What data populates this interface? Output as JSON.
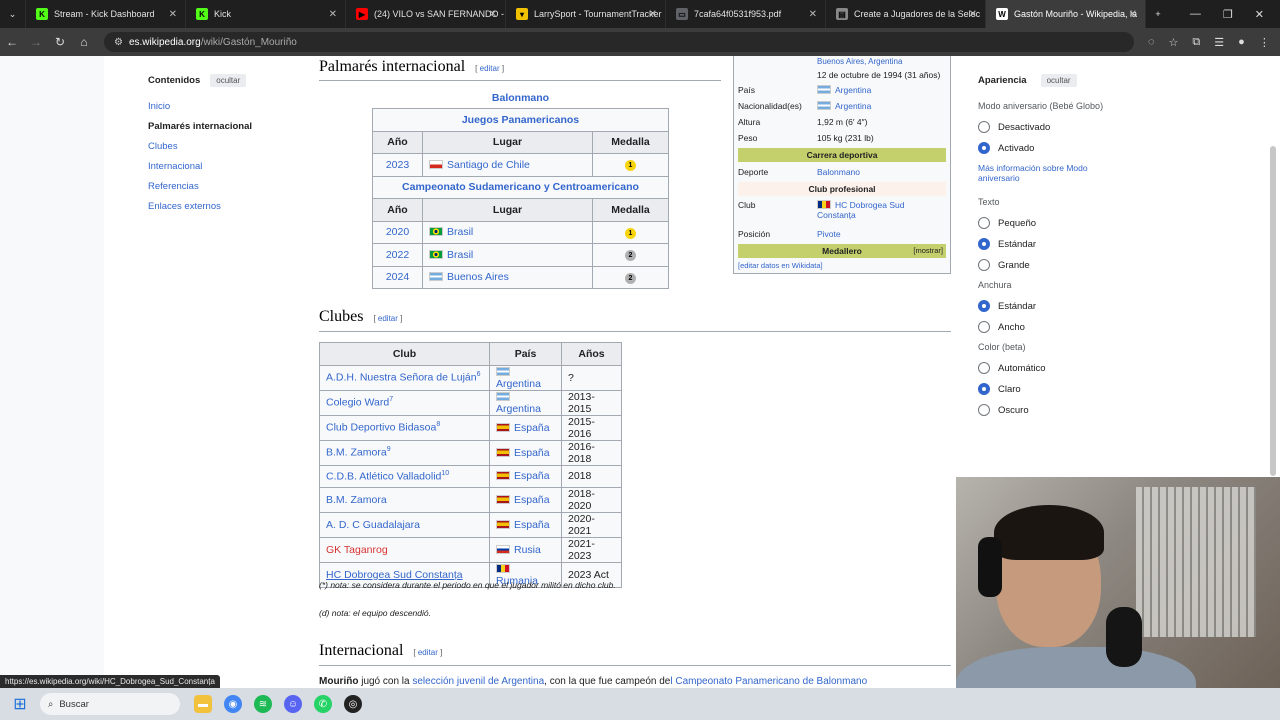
{
  "browser": {
    "tabs": [
      {
        "title": "Stream - Kick Dashboard",
        "icon": "kick-icon",
        "color": "#53fc18",
        "glyph": "K"
      },
      {
        "title": "Kick",
        "icon": "kick-icon",
        "color": "#53fc18",
        "glyph": "K"
      },
      {
        "title": "(24) VILO vs SAN FERNANDO -",
        "icon": "youtube-icon",
        "color": "#ff0000",
        "glyph": "▶"
      },
      {
        "title": "LarrySport - TournamentTracker",
        "icon": "tracker-icon",
        "color": "#f2c200",
        "glyph": "▾"
      },
      {
        "title": "7cafa64f0531f953.pdf",
        "icon": "pdf-icon",
        "color": "#5f6368",
        "glyph": "▭"
      },
      {
        "title": "Create a Jugadores de la Selec",
        "icon": "doc-icon",
        "color": "#888888",
        "glyph": "▤"
      },
      {
        "title": "Gastón Mouriño - Wikipedia, la",
        "icon": "wikipedia-icon",
        "color": "#ffffff",
        "glyph": "W"
      }
    ],
    "url_host": "es.wikipedia.org",
    "url_path": "/wiki/Gastón_Mouriño",
    "status_url": "https://es.wikipedia.org/wiki/HC_Dobrogea_Sud_Constanța"
  },
  "toc": {
    "title": "Contenidos",
    "hide": "ocultar",
    "items": [
      "Inicio",
      "Palmarés internacional",
      "Clubes",
      "Internacional",
      "Referencias",
      "Enlaces externos"
    ]
  },
  "edit": "editar",
  "palmares": {
    "heading": "Palmarés internacional",
    "sport": "Balonmano",
    "comp1": "Juegos Panamericanos",
    "comp2": "Campeonato Sudamericano y Centroamericano",
    "cols": [
      "Año",
      "Lugar",
      "Medalla"
    ],
    "rows1": [
      {
        "year": "2023",
        "place": "Santiago de Chile",
        "flag": "chile",
        "medal": "1"
      }
    ],
    "rows2": [
      {
        "year": "2020",
        "place": "Brasil",
        "flag": "brasil",
        "medal": "1"
      },
      {
        "year": "2022",
        "place": "Brasil",
        "flag": "brasil",
        "medal": "2"
      },
      {
        "year": "2024",
        "place": "Buenos Aires",
        "flag": "argentina",
        "medal": "2"
      }
    ]
  },
  "infobox": {
    "top_partial": "Buenos Aires, Argentina",
    "birth": "12 de octubre de 1994 (31 años)",
    "rows": [
      {
        "k": "País",
        "v": "Argentina"
      },
      {
        "k": "Nacionalidad(es)",
        "v": "Argentina"
      },
      {
        "k": "Altura",
        "v": "1,92 m (6′ 4″)"
      },
      {
        "k": "Peso",
        "v": "105 kg (231 lb)"
      }
    ],
    "sect_career": "Carrera deportiva",
    "sport_k": "Deporte",
    "sport_v": "Balonmano",
    "sect_club": "Club profesional",
    "club_k": "Club",
    "club_v": "HC Dobrogea Sud Constanța",
    "pos_k": "Posición",
    "pos_v": "Pivote",
    "medallero": "Medallero",
    "show": "[mostrar]",
    "wikidata": "[editar datos en Wikidata]"
  },
  "clubes": {
    "heading": "Clubes",
    "cols": [
      "Club",
      "País",
      "Años"
    ],
    "rows": [
      {
        "club": "A.D.H. Nuestra Señora de Luján",
        "sup": "6",
        "country": "Argentina",
        "flag": "argentina",
        "years": "?"
      },
      {
        "club": "Colegio Ward",
        "sup": "7",
        "country": "Argentina",
        "flag": "argentina",
        "years": "2013-2015"
      },
      {
        "club": "Club Deportivo Bidasoa",
        "sup": "8",
        "country": "España",
        "flag": "espana",
        "years": "2015-2016"
      },
      {
        "club": "B.M. Zamora",
        "sup": "9",
        "country": "España",
        "flag": "espana",
        "years": "2016-2018"
      },
      {
        "club": "C.D.B. Atlético Valladolid",
        "sup": "10",
        "country": "España",
        "flag": "espana",
        "years": "2018"
      },
      {
        "club": "B.M. Zamora",
        "sup": "",
        "country": "España",
        "flag": "espana",
        "years": "2018-2020"
      },
      {
        "club": "A. D. C Guadalajara",
        "sup": "",
        "country": "España",
        "flag": "espana",
        "years": "2020-2021"
      },
      {
        "club": "GK Taganrog",
        "sup": "",
        "country": "Rusia",
        "flag": "rusia",
        "years": "2021-2023",
        "red": true
      },
      {
        "club": "HC Dobrogea Sud Constanța",
        "sup": "",
        "country": "Rumania",
        "flag": "rumania",
        "years": "2023 Act"
      }
    ],
    "note1": "(*) nota: se considera durante el periodo en que el jugador militó en dicho club.",
    "note2": "(d) nota: el equipo descendió."
  },
  "internacional": {
    "heading": "Internacional",
    "bold": "Mouriño",
    "t1": " jugó con la ",
    "link1": "selección juvenil de Argentina",
    "t2": ", con la que fue campeón de",
    "link2": "l Campeonato Panamericano de Balonmano"
  },
  "appearance": {
    "title": "Apariencia",
    "hide": "ocultar",
    "anniv_label": "Modo aniversario (Bebé Globo)",
    "anniv_opts": [
      {
        "label": "Desactivado",
        "on": false
      },
      {
        "label": "Activado",
        "on": true
      }
    ],
    "anniv_more": "Más información sobre Modo aniversario",
    "text_label": "Texto",
    "text_opts": [
      {
        "label": "Pequeño",
        "on": false
      },
      {
        "label": "Estándar",
        "on": true
      },
      {
        "label": "Grande",
        "on": false
      }
    ],
    "width_label": "Anchura",
    "width_opts": [
      {
        "label": "Estándar",
        "on": true
      },
      {
        "label": "Ancho",
        "on": false
      }
    ],
    "color_label": "Color (beta)",
    "color_opts": [
      {
        "label": "Automático",
        "on": false
      },
      {
        "label": "Claro",
        "on": true
      },
      {
        "label": "Oscuro",
        "on": false
      }
    ]
  },
  "taskbar": {
    "search": "Buscar"
  }
}
